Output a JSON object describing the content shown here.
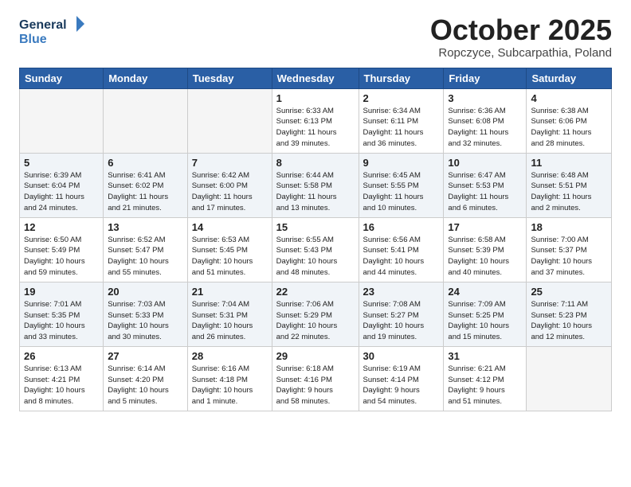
{
  "logo": {
    "line1": "General",
    "line2": "Blue"
  },
  "title": "October 2025",
  "subtitle": "Ropczyce, Subcarpathia, Poland",
  "headers": [
    "Sunday",
    "Monday",
    "Tuesday",
    "Wednesday",
    "Thursday",
    "Friday",
    "Saturday"
  ],
  "weeks": [
    [
      {
        "num": "",
        "info": ""
      },
      {
        "num": "",
        "info": ""
      },
      {
        "num": "",
        "info": ""
      },
      {
        "num": "1",
        "info": "Sunrise: 6:33 AM\nSunset: 6:13 PM\nDaylight: 11 hours\nand 39 minutes."
      },
      {
        "num": "2",
        "info": "Sunrise: 6:34 AM\nSunset: 6:11 PM\nDaylight: 11 hours\nand 36 minutes."
      },
      {
        "num": "3",
        "info": "Sunrise: 6:36 AM\nSunset: 6:08 PM\nDaylight: 11 hours\nand 32 minutes."
      },
      {
        "num": "4",
        "info": "Sunrise: 6:38 AM\nSunset: 6:06 PM\nDaylight: 11 hours\nand 28 minutes."
      }
    ],
    [
      {
        "num": "5",
        "info": "Sunrise: 6:39 AM\nSunset: 6:04 PM\nDaylight: 11 hours\nand 24 minutes."
      },
      {
        "num": "6",
        "info": "Sunrise: 6:41 AM\nSunset: 6:02 PM\nDaylight: 11 hours\nand 21 minutes."
      },
      {
        "num": "7",
        "info": "Sunrise: 6:42 AM\nSunset: 6:00 PM\nDaylight: 11 hours\nand 17 minutes."
      },
      {
        "num": "8",
        "info": "Sunrise: 6:44 AM\nSunset: 5:58 PM\nDaylight: 11 hours\nand 13 minutes."
      },
      {
        "num": "9",
        "info": "Sunrise: 6:45 AM\nSunset: 5:55 PM\nDaylight: 11 hours\nand 10 minutes."
      },
      {
        "num": "10",
        "info": "Sunrise: 6:47 AM\nSunset: 5:53 PM\nDaylight: 11 hours\nand 6 minutes."
      },
      {
        "num": "11",
        "info": "Sunrise: 6:48 AM\nSunset: 5:51 PM\nDaylight: 11 hours\nand 2 minutes."
      }
    ],
    [
      {
        "num": "12",
        "info": "Sunrise: 6:50 AM\nSunset: 5:49 PM\nDaylight: 10 hours\nand 59 minutes."
      },
      {
        "num": "13",
        "info": "Sunrise: 6:52 AM\nSunset: 5:47 PM\nDaylight: 10 hours\nand 55 minutes."
      },
      {
        "num": "14",
        "info": "Sunrise: 6:53 AM\nSunset: 5:45 PM\nDaylight: 10 hours\nand 51 minutes."
      },
      {
        "num": "15",
        "info": "Sunrise: 6:55 AM\nSunset: 5:43 PM\nDaylight: 10 hours\nand 48 minutes."
      },
      {
        "num": "16",
        "info": "Sunrise: 6:56 AM\nSunset: 5:41 PM\nDaylight: 10 hours\nand 44 minutes."
      },
      {
        "num": "17",
        "info": "Sunrise: 6:58 AM\nSunset: 5:39 PM\nDaylight: 10 hours\nand 40 minutes."
      },
      {
        "num": "18",
        "info": "Sunrise: 7:00 AM\nSunset: 5:37 PM\nDaylight: 10 hours\nand 37 minutes."
      }
    ],
    [
      {
        "num": "19",
        "info": "Sunrise: 7:01 AM\nSunset: 5:35 PM\nDaylight: 10 hours\nand 33 minutes."
      },
      {
        "num": "20",
        "info": "Sunrise: 7:03 AM\nSunset: 5:33 PM\nDaylight: 10 hours\nand 30 minutes."
      },
      {
        "num": "21",
        "info": "Sunrise: 7:04 AM\nSunset: 5:31 PM\nDaylight: 10 hours\nand 26 minutes."
      },
      {
        "num": "22",
        "info": "Sunrise: 7:06 AM\nSunset: 5:29 PM\nDaylight: 10 hours\nand 22 minutes."
      },
      {
        "num": "23",
        "info": "Sunrise: 7:08 AM\nSunset: 5:27 PM\nDaylight: 10 hours\nand 19 minutes."
      },
      {
        "num": "24",
        "info": "Sunrise: 7:09 AM\nSunset: 5:25 PM\nDaylight: 10 hours\nand 15 minutes."
      },
      {
        "num": "25",
        "info": "Sunrise: 7:11 AM\nSunset: 5:23 PM\nDaylight: 10 hours\nand 12 minutes."
      }
    ],
    [
      {
        "num": "26",
        "info": "Sunrise: 6:13 AM\nSunset: 4:21 PM\nDaylight: 10 hours\nand 8 minutes."
      },
      {
        "num": "27",
        "info": "Sunrise: 6:14 AM\nSunset: 4:20 PM\nDaylight: 10 hours\nand 5 minutes."
      },
      {
        "num": "28",
        "info": "Sunrise: 6:16 AM\nSunset: 4:18 PM\nDaylight: 10 hours\nand 1 minute."
      },
      {
        "num": "29",
        "info": "Sunrise: 6:18 AM\nSunset: 4:16 PM\nDaylight: 9 hours\nand 58 minutes."
      },
      {
        "num": "30",
        "info": "Sunrise: 6:19 AM\nSunset: 4:14 PM\nDaylight: 9 hours\nand 54 minutes."
      },
      {
        "num": "31",
        "info": "Sunrise: 6:21 AM\nSunset: 4:12 PM\nDaylight: 9 hours\nand 51 minutes."
      },
      {
        "num": "",
        "info": ""
      }
    ]
  ]
}
